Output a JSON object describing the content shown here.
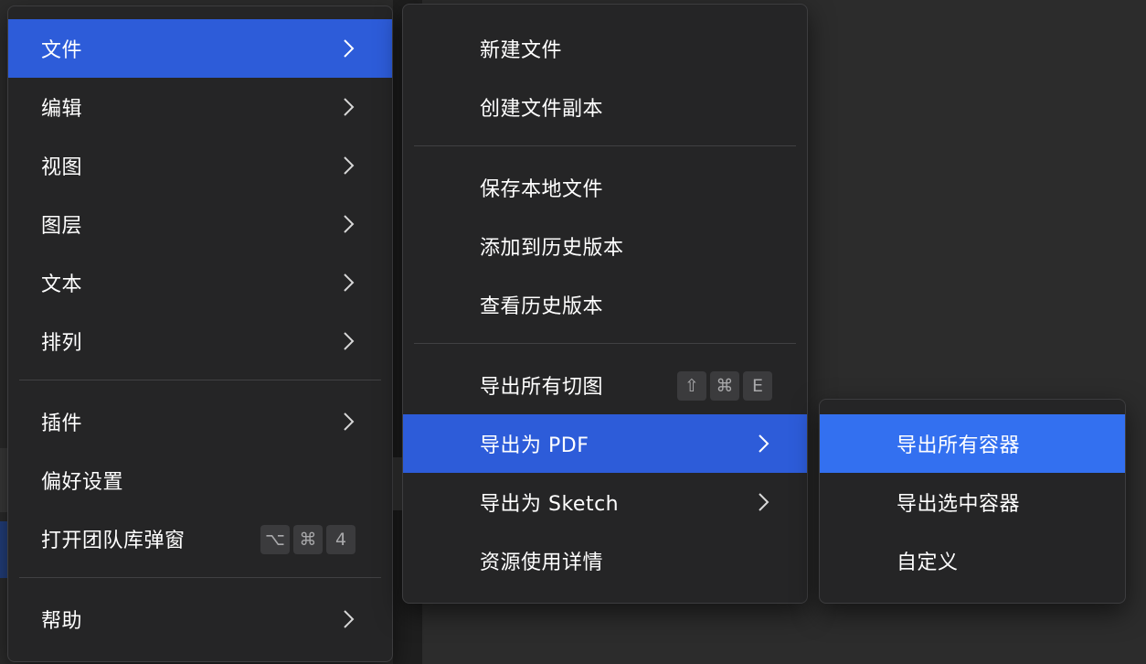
{
  "main_menu": {
    "items": [
      {
        "label": "文件",
        "submenu": true,
        "active": true
      },
      {
        "label": "编辑",
        "submenu": true
      },
      {
        "label": "视图",
        "submenu": true
      },
      {
        "label": "图层",
        "submenu": true
      },
      {
        "label": "文本",
        "submenu": true
      },
      {
        "label": "排列",
        "submenu": true
      },
      {
        "label": "插件",
        "submenu": true
      },
      {
        "label": "偏好设置"
      },
      {
        "label": "打开团队库弹窗",
        "shortcut": [
          "⌥",
          "⌘",
          "4"
        ]
      },
      {
        "label": "帮助",
        "submenu": true
      }
    ]
  },
  "file_menu": {
    "items": [
      {
        "label": "新建文件"
      },
      {
        "label": "创建文件副本"
      },
      {
        "label": "保存本地文件"
      },
      {
        "label": "添加到历史版本"
      },
      {
        "label": "查看历史版本"
      },
      {
        "label": "导出所有切图",
        "shortcut": [
          "⇧",
          "⌘",
          "E"
        ]
      },
      {
        "label": "导出为 PDF",
        "submenu": true,
        "active": true
      },
      {
        "label": "导出为 Sketch",
        "submenu": true
      },
      {
        "label": "资源使用详情"
      }
    ]
  },
  "pdf_menu": {
    "items": [
      {
        "label": "导出所有容器",
        "active": true
      },
      {
        "label": "导出选中容器"
      },
      {
        "label": "自定义"
      }
    ]
  },
  "colors": {
    "menu_bg": "#252526",
    "active_bg": "#2d5cd9",
    "active_bg_bright": "#3370f0",
    "separator": "#414143",
    "key_bg": "#3b3b3d"
  },
  "icons": {
    "submenu": "chevron-right-icon"
  }
}
